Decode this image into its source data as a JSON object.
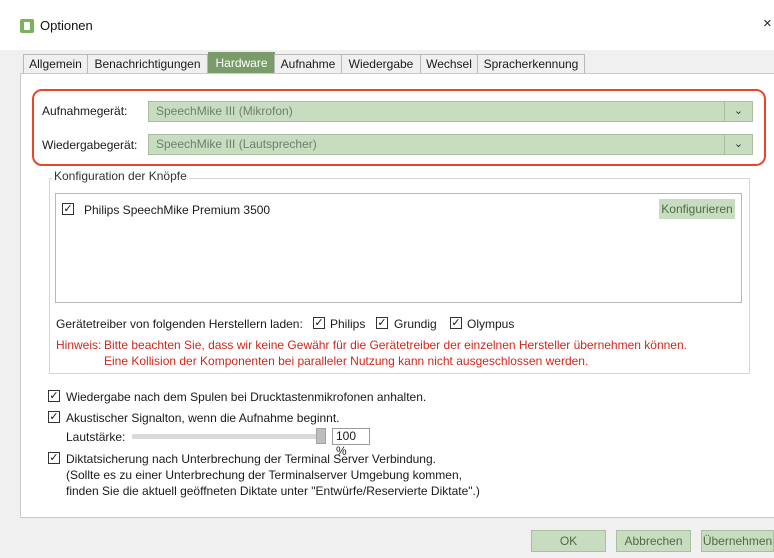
{
  "window": {
    "title": "Optionen",
    "close_glyph": "×"
  },
  "tabs": [
    {
      "label": "Allgemein"
    },
    {
      "label": "Benachrichtigungen"
    },
    {
      "label": "Hardware"
    },
    {
      "label": "Aufnahme"
    },
    {
      "label": "Wiedergabe"
    },
    {
      "label": "Wechsel"
    },
    {
      "label": "Spracherkennung"
    }
  ],
  "devices": {
    "recording_label": "Aufnahmegerät:",
    "recording_value": "SpeechMike III (Mikrofon)",
    "playback_label": "Wiedergabegerät:",
    "playback_value": "SpeechMike III (Lautsprecher)",
    "dropdown_glyph": "⌄"
  },
  "buttons_config": {
    "legend": "Konfiguration der Knöpfe",
    "items": [
      {
        "label": "Philips SpeechMike Premium 3500",
        "checked": true
      }
    ],
    "configure_label": "Konfigurieren"
  },
  "drivers": {
    "label": "Gerätetreiber von folgenden Herstellern laden:",
    "vendors": [
      {
        "label": "Philips",
        "checked": true
      },
      {
        "label": "Grundig",
        "checked": true
      },
      {
        "label": "Olympus",
        "checked": true
      }
    ]
  },
  "notice": {
    "label": "Hinweis:",
    "line1": "Bitte beachten Sie, dass wir keine Gewähr für die Gerätetreiber der einzelnen Hersteller übernehmen können.",
    "line2": "Eine Kollision der Komponenten bei paralleler Nutzung kann nicht ausgeschlossen werden."
  },
  "options": {
    "pause_playback": {
      "label": "Wiedergabe nach dem Spulen bei Drucktastenmikrofonen anhalten.",
      "checked": true
    },
    "acoustic_signal": {
      "label": "Akustischer Signalton, wenn die Aufnahme beginnt.",
      "checked": true
    },
    "volume_label": "Lautstärke:",
    "volume_value": "100 %",
    "volume_fraction": 1.0,
    "backup": {
      "label": "Diktatsicherung nach Unterbrechung der Terminal Server Verbindung.",
      "note_line1": "(Sollte es zu einer Unterbrechung der Terminalserver Umgebung kommen,",
      "note_line2": "finden Sie die aktuell geöffneten Diktate unter \"Entwürfe/Reservierte Diktate\".)",
      "checked": true
    }
  },
  "footer": {
    "ok": "OK",
    "cancel": "Abbrechen",
    "apply": "Übernehmen"
  },
  "colors": {
    "accent": "#7a9c6a",
    "highlight": "#e8462c",
    "warning": "#d2261c",
    "button_bg": "#c8ddc0"
  },
  "check_glyph": "✓"
}
